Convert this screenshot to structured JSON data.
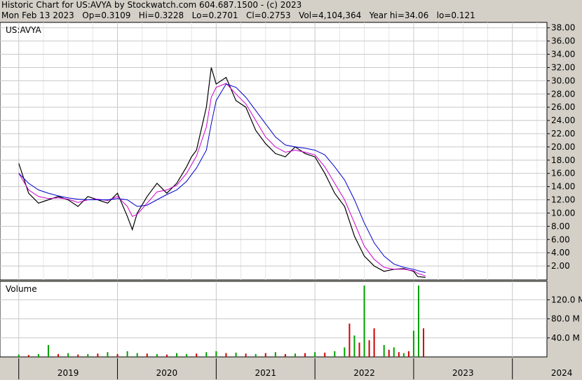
{
  "header": {
    "line1": "Historic Chart for US:AVYA by Stockwatch.com 604.687.1500 - (c) 2023",
    "line2": "Mon Feb 13 2023   Op=0.3109   Hi=0.3228   Lo=0.2701   Cl=0.2753   Vol=4,104,364   Year hi=34.06   lo=0.121"
  },
  "colors": {
    "background": "#ffffff",
    "frame": "#d4d0c8",
    "grid": "#c8c8c8",
    "price": "#000000",
    "ma_short": "#cc00cc",
    "ma_long": "#0000cc",
    "vol_up": "#00a000",
    "vol_down": "#d00000"
  },
  "chart_data": [
    {
      "type": "line",
      "panel": "price",
      "title": "US:AVYA",
      "y_ticks": [
        "2.00",
        "4.00",
        "6.00",
        "8.00",
        "10.00",
        "12.00",
        "14.00",
        "16.00",
        "18.00",
        "20.00",
        "22.00",
        "24.00",
        "26.00",
        "28.00",
        "30.00",
        "32.00",
        "34.00",
        "36.00",
        "38.00"
      ],
      "ylim": [
        0,
        38.5
      ],
      "x_ticks": [
        "2019",
        "2020",
        "2021",
        "2022",
        "2023",
        "2024"
      ],
      "x": [
        2019.0,
        2019.1,
        2019.2,
        2019.3,
        2019.4,
        2019.5,
        2019.6,
        2019.7,
        2019.8,
        2019.9,
        2020.0,
        2020.1,
        2020.15,
        2020.2,
        2020.3,
        2020.4,
        2020.5,
        2020.6,
        2020.7,
        2020.75,
        2020.8,
        2020.9,
        2020.95,
        2021.0,
        2021.1,
        2021.2,
        2021.3,
        2021.4,
        2021.5,
        2021.6,
        2021.7,
        2021.8,
        2021.9,
        2022.0,
        2022.1,
        2022.2,
        2022.3,
        2022.4,
        2022.5,
        2022.6,
        2022.7,
        2022.8,
        2022.9,
        2023.0,
        2023.04,
        2023.12
      ],
      "series": [
        {
          "values": [
            17.5,
            13.0,
            11.5,
            12.0,
            12.5,
            12.0,
            11.0,
            12.5,
            12.0,
            11.5,
            13.0,
            9.5,
            7.5,
            10.0,
            12.5,
            14.5,
            13.0,
            14.5,
            17.0,
            18.5,
            19.5,
            26.0,
            32.0,
            29.5,
            30.5,
            27.0,
            26.0,
            22.5,
            20.5,
            19.0,
            18.5,
            20.0,
            19.0,
            18.5,
            16.0,
            13.0,
            11.0,
            6.5,
            3.5,
            2.0,
            1.2,
            1.5,
            1.6,
            1.2,
            0.4,
            0.28
          ]
        },
        {
          "values": [
            16.0,
            13.5,
            12.5,
            12.2,
            12.3,
            12.1,
            11.6,
            12.0,
            12.1,
            11.9,
            12.5,
            11.0,
            9.5,
            9.8,
            11.5,
            13.2,
            13.5,
            14.2,
            16.0,
            17.3,
            18.6,
            23.0,
            27.5,
            29.0,
            29.6,
            28.0,
            26.5,
            24.0,
            21.5,
            20.0,
            19.2,
            19.5,
            19.2,
            18.8,
            17.0,
            14.5,
            12.0,
            8.5,
            5.0,
            3.0,
            1.8,
            1.5,
            1.5,
            1.3,
            0.9,
            0.5
          ]
        },
        {
          "values": [
            16.0,
            14.5,
            13.5,
            13.0,
            12.6,
            12.3,
            12.1,
            12.0,
            12.0,
            12.0,
            12.2,
            12.0,
            11.5,
            11.0,
            11.2,
            12.0,
            12.8,
            13.5,
            14.8,
            15.8,
            16.8,
            19.5,
            23.5,
            27.0,
            29.5,
            29.0,
            27.5,
            25.5,
            23.5,
            21.5,
            20.3,
            20.0,
            19.8,
            19.5,
            18.8,
            17.0,
            15.0,
            12.0,
            8.5,
            5.5,
            3.5,
            2.3,
            1.8,
            1.5,
            1.3,
            1.0
          ]
        }
      ]
    },
    {
      "type": "bar",
      "panel": "volume",
      "title": "Volume",
      "y_ticks": [
        "40.0 M",
        "80.0 M",
        "120.0 M"
      ],
      "ylim": [
        0,
        150
      ],
      "x": [
        2019.0,
        2019.1,
        2019.2,
        2019.3,
        2019.4,
        2019.5,
        2019.6,
        2019.7,
        2019.8,
        2019.9,
        2020.0,
        2020.1,
        2020.2,
        2020.3,
        2020.4,
        2020.5,
        2020.6,
        2020.7,
        2020.8,
        2020.9,
        2021.0,
        2021.1,
        2021.2,
        2021.3,
        2021.4,
        2021.5,
        2021.6,
        2021.7,
        2021.8,
        2021.9,
        2022.0,
        2022.1,
        2022.2,
        2022.3,
        2022.35,
        2022.4,
        2022.45,
        2022.5,
        2022.55,
        2022.6,
        2022.7,
        2022.75,
        2022.8,
        2022.85,
        2022.9,
        2022.95,
        2023.0,
        2023.05,
        2023.1
      ],
      "values": [
        5,
        4,
        6,
        25,
        6,
        8,
        5,
        6,
        7,
        10,
        6,
        12,
        8,
        7,
        6,
        5,
        8,
        6,
        7,
        10,
        12,
        8,
        9,
        7,
        6,
        8,
        10,
        6,
        7,
        8,
        10,
        9,
        12,
        20,
        70,
        45,
        30,
        150,
        35,
        60,
        25,
        15,
        20,
        10,
        8,
        12,
        55,
        150,
        60
      ],
      "up": [
        1,
        0,
        1,
        1,
        0,
        1,
        0,
        1,
        0,
        1,
        0,
        1,
        1,
        0,
        1,
        0,
        1,
        1,
        0,
        1,
        1,
        0,
        1,
        0,
        1,
        0,
        1,
        0,
        1,
        0,
        1,
        0,
        1,
        1,
        0,
        1,
        0,
        1,
        0,
        0,
        1,
        0,
        1,
        0,
        1,
        0,
        1,
        1,
        0
      ]
    }
  ]
}
